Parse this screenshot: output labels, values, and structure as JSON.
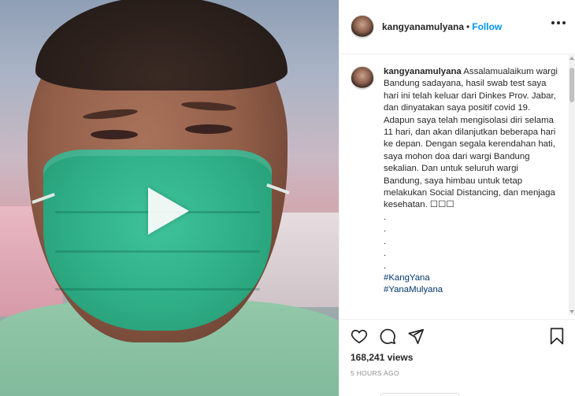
{
  "post": {
    "username": "kangyanamulyana",
    "follow_label": "Follow",
    "separator": "•",
    "caption_user": "kangyanamulyana",
    "caption_text": " Assalamualaikum wargi Bandung sadayana, hasil swab test saya hari ini telah keluar dari Dinkes Prov. Jabar, dan dinyatakan saya positif covid 19. Adapun saya telah mengisolasi diri selama 11 hari, dan akan dilanjutkan beberapa hari ke depan. Dengan segala kerendahan hati, saya mohon doa dari wargi Bandung sekalian. Dan untuk seluruh wargi Bandung, saya himbau untuk tetap melakukan Social Distancing, dan menjaga kesehatan. ☐☐☐",
    "dots": [
      ".",
      ".",
      ".",
      ".",
      "."
    ],
    "hashtags": [
      "#KangYana",
      "#YanaMulyana"
    ],
    "views": "168,241 views",
    "time": "5 HOURS AGO"
  },
  "icons": {
    "play": "play-icon",
    "like": "heart-icon",
    "comment": "comment-icon",
    "share": "paper-plane-icon",
    "save": "bookmark-icon",
    "more": "more-options-icon"
  },
  "colors": {
    "follow": "#0095f6",
    "hashtag": "#00376b",
    "mask": "#2fae86",
    "muted": "#8e8e8e"
  }
}
